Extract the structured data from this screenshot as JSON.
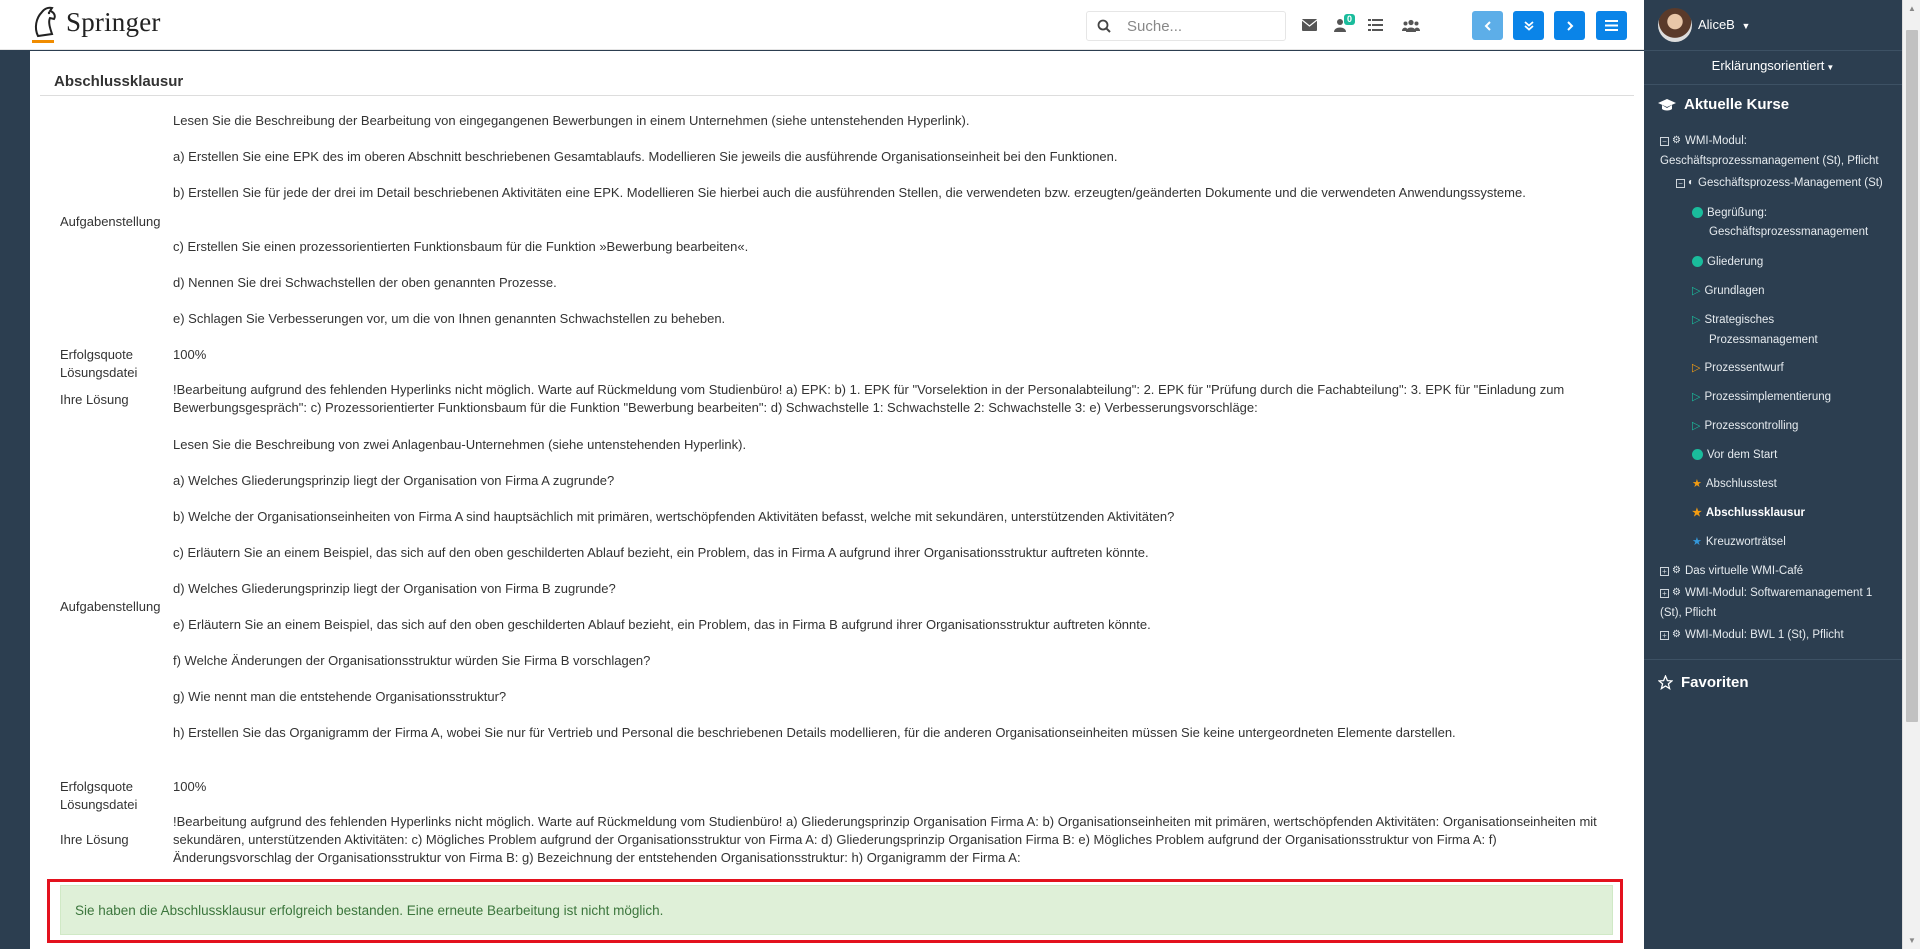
{
  "topbar": {
    "logo_text": "Springer",
    "search_placeholder": "Suche...",
    "notification_count": "0",
    "icons": [
      "search-icon",
      "envelope-icon",
      "user-bell-icon",
      "list-icon",
      "users-icon",
      "chevron-left-icon",
      "double-chevron-down-icon",
      "chevron-right-icon",
      "menu-icon"
    ]
  },
  "main": {
    "title": "Abschlussklausur",
    "q1": {
      "label_task": "Aufgabenstellung",
      "intro": "Lesen Sie die Beschreibung der Bearbeitung von eingegangenen Bewerbungen in einem Unternehmen (siehe untenstehenden Hyperlink).",
      "a": "a) Erstellen Sie eine EPK des im oberen Abschnitt beschriebenen Gesamtablaufs. Modellieren Sie jeweils die ausführende Organisationseinheit bei den Funktionen.",
      "b": "b) Erstellen Sie für jede der drei im Detail beschriebenen Aktivitäten eine EPK. Modellieren Sie hierbei auch die ausführenden Stellen, die verwendeten bzw. erzeugten/geänderten Dokumente und die verwendeten Anwendungssysteme.",
      "c": "c) Erstellen Sie einen prozessorientierten Funktionsbaum für die Funktion »Bewerbung bearbeiten«.",
      "d": "d) Nennen Sie drei Schwachstellen der oben genannten Prozesse.",
      "e": "e) Schlagen Sie Verbesserungen vor, um die von Ihnen genannten Schwachstellen zu beheben.",
      "label_quote": "Erfolgsquote",
      "quote": "100%",
      "label_file": "Lösungsdatei",
      "label_solution": "Ihre Lösung",
      "solution": "!Bearbeitung aufgrund des fehlenden Hyperlinks nicht möglich. Warte auf Rückmeldung vom Studienbüro! a) EPK: b) 1. EPK für \"Vorselektion in der Personalabteilung\": 2. EPK für \"Prüfung durch die Fachabteilung\": 3. EPK für \"Einladung zum Bewerbungsgespräch\": c) Prozessorientierter Funktionsbaum für die Funktion \"Bewerbung bearbeiten\": d) Schwachstelle 1: Schwachstelle 2: Schwachstelle 3: e) Verbesserungsvorschläge:"
    },
    "q2": {
      "label_task": "Aufgabenstellung",
      "intro": "Lesen Sie die Beschreibung von zwei Anlagenbau-Unternehmen (siehe untenstehenden Hyperlink).",
      "a": "a) Welches Gliederungsprinzip liegt der Organisation von Firma A zugrunde?",
      "b": "b) Welche der Organisationseinheiten von Firma A sind hauptsächlich mit primären, wertschöpfenden Aktivitäten befasst, welche mit sekundären, unterstützenden Aktivitäten?",
      "c": "c) Erläutern Sie an einem Beispiel, das sich auf den oben geschilderten Ablauf bezieht, ein Problem, das in Firma A aufgrund ihrer Organisationsstruktur auftreten könnte.",
      "d": "d) Welches Gliederungsprinzip liegt der Organisation von Firma B zugrunde?",
      "e": "e) Erläutern Sie an einem Beispiel, das sich auf den oben geschilderten Ablauf bezieht, ein Problem, das in Firma B aufgrund ihrer Organisationsstruktur auftreten könnte.",
      "f": "f) Welche Änderungen der Organisationsstruktur würden Sie Firma B vorschlagen?",
      "g": "g) Wie nennt man die entstehende Organisationsstruktur?",
      "h": "h) Erstellen Sie das Organigramm der Firma A, wobei Sie nur für Vertrieb und Personal die beschriebenen Details modellieren, für die anderen Organisationseinheiten müssen Sie keine untergeordneten Elemente darstellen.",
      "label_quote": "Erfolgsquote",
      "quote": "100%",
      "label_file": "Lösungsdatei",
      "label_solution": "Ihre Lösung",
      "solution": "!Bearbeitung aufgrund des fehlenden Hyperlinks nicht möglich. Warte auf Rückmeldung vom Studienbüro! a) Gliederungsprinzip Organisation Firma A: b) Organisationseinheiten mit primären, wertschöpfenden Aktivitäten: Organisationseinheiten mit sekundären, unterstützenden Aktivitäten: c) Mögliches Problem aufgrund der Organisationsstruktur von Firma A: d) Gliederungsprinzip Organisation Firma B: e) Mögliches Problem aufgrund der Organisationsstruktur von Firma A: f) Änderungsvorschlag der Organisationsstruktur von Firma B: g) Bezeichnung der entstehenden Organisationsstruktur: h) Organigramm der Firma A:"
    },
    "alert": "Sie haben die Abschlussklausur erfolgreich bestanden. Eine erneute Bearbeitung ist nicht möglich."
  },
  "sidebar": {
    "username": "AliceB",
    "mode": "Erklärungsorientiert",
    "courses_heading": "Aktuelle Kurse",
    "favorites_heading": "Favoriten",
    "course1_line1": "WMI-Modul:",
    "course1_line2": "Geschäftsprozessmanagement (St), Pflicht",
    "subcourse": "Geschäftsprozess-Management (St)",
    "items": [
      {
        "label": "Begrüßung:",
        "label2": "Geschäftsprozessmanagement",
        "marker": "dot",
        "color": "#1abc9c"
      },
      {
        "label": "Gliederung",
        "marker": "dot",
        "color": "#1abc9c"
      },
      {
        "label": "Grundlagen",
        "marker": "play",
        "color": "#1abc9c"
      },
      {
        "label": "Strategisches",
        "label2": "Prozessmanagement",
        "marker": "play",
        "color": "#1abc9c"
      },
      {
        "label": "Prozessentwurf",
        "marker": "play",
        "color": "#f39c12"
      },
      {
        "label": "Prozessimplementierung",
        "marker": "play",
        "color": "#1abc9c"
      },
      {
        "label": "Prozesscontrolling",
        "marker": "play",
        "color": "#1abc9c"
      },
      {
        "label": "Vor dem Start",
        "marker": "dot",
        "color": "#1abc9c"
      },
      {
        "label": "Abschlusstest",
        "marker": "star",
        "color": "#f39c12"
      },
      {
        "label": "Abschlussklausur",
        "marker": "star",
        "color": "#f39c12"
      },
      {
        "label": "Kreuzworträtsel",
        "marker": "star",
        "color": "#3498db"
      }
    ],
    "course2": "Das virtuelle WMI-Café",
    "course3_line1": "WMI-Modul: Softwaremanagement 1",
    "course3_line2": "(St), Pflicht",
    "course4": "WMI-Modul: BWL 1 (St), Pflicht"
  }
}
